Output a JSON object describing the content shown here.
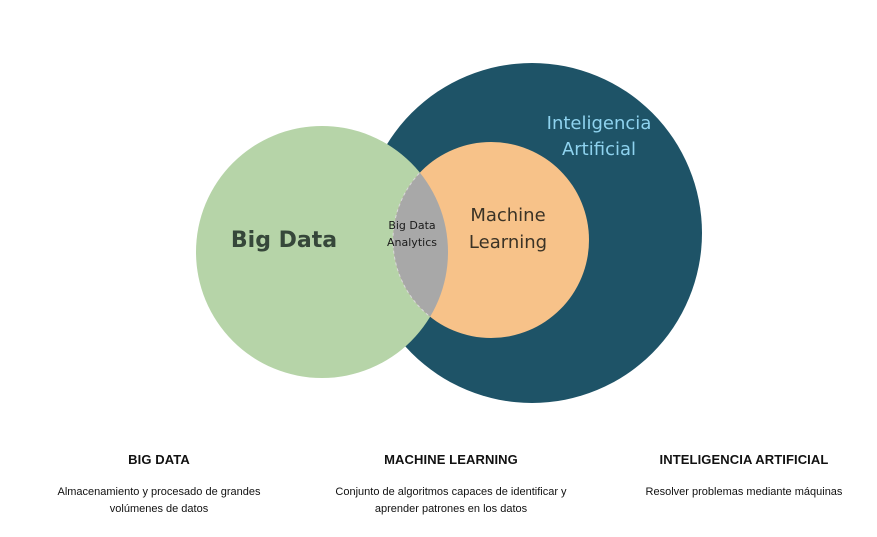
{
  "diagram": {
    "circles": {
      "big_data": {
        "label": "Big Data",
        "color": "#b6d4a8"
      },
      "ai": {
        "label_lines": [
          "Inteligencia",
          "Artificial"
        ],
        "color": "#1e5367",
        "label_color": "#8fd3ef"
      },
      "ml": {
        "label_lines": [
          "Machine",
          "Learning"
        ],
        "color": "#f7c289"
      },
      "analytics": {
        "label_lines": [
          "Big Data",
          "Analytics"
        ],
        "color": "#a8a8a8"
      }
    }
  },
  "captions": {
    "big_data": {
      "title": "BIG DATA",
      "description": "Almacenamiento y procesado de grandes\nvolúmenes de datos"
    },
    "machine_learning": {
      "title": "MACHINE LEARNING",
      "description": "Conjunto de algoritmos capaces de identificar y\naprender patrones en los datos"
    },
    "ai": {
      "title": "INTELIGENCIA ARTIFICIAL",
      "description": "Resolver problemas mediante máquinas"
    }
  }
}
